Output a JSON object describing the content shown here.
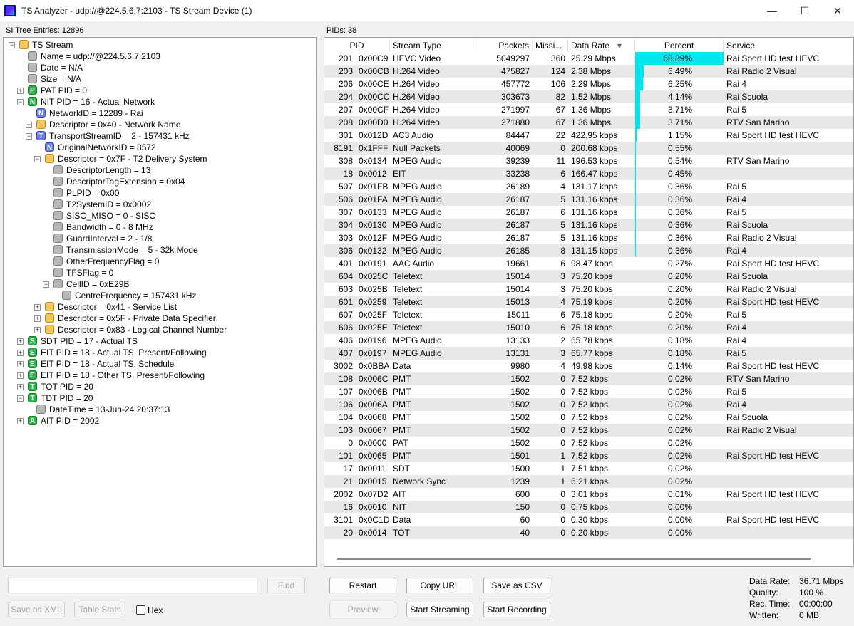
{
  "window": {
    "title": "TS Analyzer - udp://@224.5.6.7:2103 - TS Stream Device (1)",
    "minimize": "—",
    "maximize": "☐",
    "close": "✕"
  },
  "left": {
    "header": "SI Tree Entries: 12896",
    "tree": [
      {
        "depth": 0,
        "exp": "-",
        "icon": "folder",
        "letter": "",
        "text": "TS Stream"
      },
      {
        "depth": 1,
        "exp": "",
        "icon": "gray",
        "letter": "",
        "text": "Name = udp://@224.5.6.7:2103"
      },
      {
        "depth": 1,
        "exp": "",
        "icon": "gray",
        "letter": "",
        "text": "Date = N/A"
      },
      {
        "depth": 1,
        "exp": "",
        "icon": "gray",
        "letter": "",
        "text": "Size = N/A"
      },
      {
        "depth": 1,
        "exp": "+",
        "icon": "green",
        "letter": "P",
        "text": "PAT PID = 0"
      },
      {
        "depth": 1,
        "exp": "-",
        "icon": "green",
        "letter": "N",
        "text": "NIT PID = 16 - Actual Network"
      },
      {
        "depth": 2,
        "exp": "",
        "icon": "blue",
        "letter": "N",
        "text": "NetworkID = 12289 - Rai"
      },
      {
        "depth": 2,
        "exp": "+",
        "icon": "folder",
        "letter": "",
        "text": "Descriptor = 0x40 - Network Name"
      },
      {
        "depth": 2,
        "exp": "-",
        "icon": "blue",
        "letter": "T",
        "text": "TransportStreamID = 2 - 157431 kHz"
      },
      {
        "depth": 3,
        "exp": "",
        "icon": "blue",
        "letter": "N",
        "text": "OriginalNetworkID = 8572"
      },
      {
        "depth": 3,
        "exp": "-",
        "icon": "folder",
        "letter": "",
        "text": "Descriptor = 0x7F - T2 Delivery System"
      },
      {
        "depth": 4,
        "exp": "",
        "icon": "gray",
        "letter": "",
        "text": "DescriptorLength = 13"
      },
      {
        "depth": 4,
        "exp": "",
        "icon": "gray",
        "letter": "",
        "text": "DescriptorTagExtension = 0x04"
      },
      {
        "depth": 4,
        "exp": "",
        "icon": "gray",
        "letter": "",
        "text": "PLPID = 0x00"
      },
      {
        "depth": 4,
        "exp": "",
        "icon": "gray",
        "letter": "",
        "text": "T2SystemID = 0x0002"
      },
      {
        "depth": 4,
        "exp": "",
        "icon": "gray",
        "letter": "",
        "text": "SISO_MISO = 0 - SISO"
      },
      {
        "depth": 4,
        "exp": "",
        "icon": "gray",
        "letter": "",
        "text": "Bandwidth = 0 - 8 MHz"
      },
      {
        "depth": 4,
        "exp": "",
        "icon": "gray",
        "letter": "",
        "text": "GuardInterval = 2 - 1/8"
      },
      {
        "depth": 4,
        "exp": "",
        "icon": "gray",
        "letter": "",
        "text": "TransmissionMode = 5 - 32k Mode"
      },
      {
        "depth": 4,
        "exp": "",
        "icon": "gray",
        "letter": "",
        "text": "OtherFrequencyFlag = 0"
      },
      {
        "depth": 4,
        "exp": "",
        "icon": "gray",
        "letter": "",
        "text": "TFSFlag = 0"
      },
      {
        "depth": 4,
        "exp": "-",
        "icon": "gray",
        "letter": "",
        "text": "CellID = 0xE29B"
      },
      {
        "depth": 5,
        "exp": "",
        "icon": "gray",
        "letter": "",
        "text": "CentreFrequency = 157431 kHz"
      },
      {
        "depth": 3,
        "exp": "+",
        "icon": "folder",
        "letter": "",
        "text": "Descriptor = 0x41 - Service List"
      },
      {
        "depth": 3,
        "exp": "+",
        "icon": "folder",
        "letter": "",
        "text": "Descriptor = 0x5F - Private Data Specifier"
      },
      {
        "depth": 3,
        "exp": "+",
        "icon": "folder",
        "letter": "",
        "text": "Descriptor = 0x83 - Logical Channel Number"
      },
      {
        "depth": 1,
        "exp": "+",
        "icon": "green",
        "letter": "S",
        "text": "SDT PID = 17 - Actual TS"
      },
      {
        "depth": 1,
        "exp": "+",
        "icon": "green",
        "letter": "E",
        "text": "EIT PID = 18 - Actual TS, Present/Following"
      },
      {
        "depth": 1,
        "exp": "+",
        "icon": "green",
        "letter": "E",
        "text": "EIT PID = 18 - Actual TS, Schedule"
      },
      {
        "depth": 1,
        "exp": "+",
        "icon": "green",
        "letter": "E",
        "text": "EIT PID = 18 - Other TS, Present/Following"
      },
      {
        "depth": 1,
        "exp": "+",
        "icon": "green",
        "letter": "T",
        "text": "TOT PID = 20"
      },
      {
        "depth": 1,
        "exp": "-",
        "icon": "green",
        "letter": "T",
        "text": "TDT PID = 20"
      },
      {
        "depth": 2,
        "exp": "",
        "icon": "gray",
        "letter": "",
        "text": "DateTime = 13-Jun-24 20:37:13"
      },
      {
        "depth": 1,
        "exp": "+",
        "icon": "green",
        "letter": "A",
        "text": "AIT PID = 2002"
      }
    ],
    "find_button": "Find",
    "search_value": "",
    "save_xml_button": "Save as XML",
    "table_stats_button": "Table Stats",
    "hex_label": "Hex"
  },
  "right": {
    "header": "PIDs: 38",
    "columns": [
      "PID",
      "Stream Type",
      "Packets",
      "Missi...",
      "Data Rate",
      "Percent",
      "Service"
    ],
    "sort_arrow": "▾",
    "rows": [
      {
        "pid": "201",
        "hex": "0x00C9",
        "type": "HEVC Video",
        "packets": "5049297",
        "missing": "360",
        "rate": "25.29 Mbps",
        "percent": "68.89%",
        "pct": 68.89,
        "service": "Rai Sport HD test HEVC"
      },
      {
        "pid": "203",
        "hex": "0x00CB",
        "type": "H.264 Video",
        "packets": "475827",
        "missing": "124",
        "rate": "2.38 Mbps",
        "percent": "6.49%",
        "pct": 6.49,
        "service": "Rai Radio 2 Visual"
      },
      {
        "pid": "206",
        "hex": "0x00CE",
        "type": "H.264 Video",
        "packets": "457772",
        "missing": "106",
        "rate": "2.29 Mbps",
        "percent": "6.25%",
        "pct": 6.25,
        "service": "Rai 4"
      },
      {
        "pid": "204",
        "hex": "0x00CC",
        "type": "H.264 Video",
        "packets": "303673",
        "missing": "82",
        "rate": "1.52 Mbps",
        "percent": "4.14%",
        "pct": 4.14,
        "service": "Rai Scuola"
      },
      {
        "pid": "207",
        "hex": "0x00CF",
        "type": "H.264 Video",
        "packets": "271997",
        "missing": "67",
        "rate": "1.36 Mbps",
        "percent": "3.71%",
        "pct": 3.71,
        "service": "Rai 5"
      },
      {
        "pid": "208",
        "hex": "0x00D0",
        "type": "H.264 Video",
        "packets": "271880",
        "missing": "67",
        "rate": "1.36 Mbps",
        "percent": "3.71%",
        "pct": 3.71,
        "service": "RTV San Marino"
      },
      {
        "pid": "301",
        "hex": "0x012D",
        "type": "AC3 Audio",
        "packets": "84447",
        "missing": "22",
        "rate": "422.95 kbps",
        "percent": "1.15%",
        "pct": 1.15,
        "service": "Rai Sport HD test HEVC"
      },
      {
        "pid": "8191",
        "hex": "0x1FFF",
        "type": "Null Packets",
        "packets": "40069",
        "missing": "0",
        "rate": "200.68 kbps",
        "percent": "0.55%",
        "pct": 0.55,
        "service": ""
      },
      {
        "pid": "308",
        "hex": "0x0134",
        "type": "MPEG Audio",
        "packets": "39239",
        "missing": "11",
        "rate": "196.53 kbps",
        "percent": "0.54%",
        "pct": 0.54,
        "service": "RTV San Marino"
      },
      {
        "pid": "18",
        "hex": "0x0012",
        "type": "EIT",
        "packets": "33238",
        "missing": "6",
        "rate": "166.47 kbps",
        "percent": "0.45%",
        "pct": 0.45,
        "service": ""
      },
      {
        "pid": "507",
        "hex": "0x01FB",
        "type": "MPEG Audio",
        "packets": "26189",
        "missing": "4",
        "rate": "131.17 kbps",
        "percent": "0.36%",
        "pct": 0.36,
        "service": "Rai 5"
      },
      {
        "pid": "506",
        "hex": "0x01FA",
        "type": "MPEG Audio",
        "packets": "26187",
        "missing": "5",
        "rate": "131.16 kbps",
        "percent": "0.36%",
        "pct": 0.36,
        "service": "Rai 4"
      },
      {
        "pid": "307",
        "hex": "0x0133",
        "type": "MPEG Audio",
        "packets": "26187",
        "missing": "6",
        "rate": "131.16 kbps",
        "percent": "0.36%",
        "pct": 0.36,
        "service": "Rai 5"
      },
      {
        "pid": "304",
        "hex": "0x0130",
        "type": "MPEG Audio",
        "packets": "26187",
        "missing": "5",
        "rate": "131.16 kbps",
        "percent": "0.36%",
        "pct": 0.36,
        "service": "Rai Scuola"
      },
      {
        "pid": "303",
        "hex": "0x012F",
        "type": "MPEG Audio",
        "packets": "26187",
        "missing": "5",
        "rate": "131.16 kbps",
        "percent": "0.36%",
        "pct": 0.36,
        "service": "Rai Radio 2 Visual"
      },
      {
        "pid": "306",
        "hex": "0x0132",
        "type": "MPEG Audio",
        "packets": "26185",
        "missing": "8",
        "rate": "131.15 kbps",
        "percent": "0.36%",
        "pct": 0.36,
        "service": "Rai 4"
      },
      {
        "pid": "401",
        "hex": "0x0191",
        "type": "AAC Audio",
        "packets": "19661",
        "missing": "6",
        "rate": "98.47 kbps",
        "percent": "0.27%",
        "pct": 0.27,
        "service": "Rai Sport HD test HEVC"
      },
      {
        "pid": "604",
        "hex": "0x025C",
        "type": "Teletext",
        "packets": "15014",
        "missing": "3",
        "rate": "75.20 kbps",
        "percent": "0.20%",
        "pct": 0.2,
        "service": "Rai Scuola"
      },
      {
        "pid": "603",
        "hex": "0x025B",
        "type": "Teletext",
        "packets": "15014",
        "missing": "3",
        "rate": "75.20 kbps",
        "percent": "0.20%",
        "pct": 0.2,
        "service": "Rai Radio 2 Visual"
      },
      {
        "pid": "601",
        "hex": "0x0259",
        "type": "Teletext",
        "packets": "15013",
        "missing": "4",
        "rate": "75.19 kbps",
        "percent": "0.20%",
        "pct": 0.2,
        "service": "Rai Sport HD test HEVC"
      },
      {
        "pid": "607",
        "hex": "0x025F",
        "type": "Teletext",
        "packets": "15011",
        "missing": "6",
        "rate": "75.18 kbps",
        "percent": "0.20%",
        "pct": 0.2,
        "service": "Rai 5"
      },
      {
        "pid": "606",
        "hex": "0x025E",
        "type": "Teletext",
        "packets": "15010",
        "missing": "6",
        "rate": "75.18 kbps",
        "percent": "0.20%",
        "pct": 0.2,
        "service": "Rai 4"
      },
      {
        "pid": "406",
        "hex": "0x0196",
        "type": "MPEG Audio",
        "packets": "13133",
        "missing": "2",
        "rate": "65.78 kbps",
        "percent": "0.18%",
        "pct": 0.18,
        "service": "Rai 4"
      },
      {
        "pid": "407",
        "hex": "0x0197",
        "type": "MPEG Audio",
        "packets": "13131",
        "missing": "3",
        "rate": "65.77 kbps",
        "percent": "0.18%",
        "pct": 0.18,
        "service": "Rai 5"
      },
      {
        "pid": "3002",
        "hex": "0x0BBA",
        "type": "Data",
        "packets": "9980",
        "missing": "4",
        "rate": "49.98 kbps",
        "percent": "0.14%",
        "pct": 0.14,
        "service": "Rai Sport HD test HEVC"
      },
      {
        "pid": "108",
        "hex": "0x006C",
        "type": "PMT",
        "packets": "1502",
        "missing": "0",
        "rate": "7.52 kbps",
        "percent": "0.02%",
        "pct": 0.02,
        "service": "RTV San Marino"
      },
      {
        "pid": "107",
        "hex": "0x006B",
        "type": "PMT",
        "packets": "1502",
        "missing": "0",
        "rate": "7.52 kbps",
        "percent": "0.02%",
        "pct": 0.02,
        "service": "Rai 5"
      },
      {
        "pid": "106",
        "hex": "0x006A",
        "type": "PMT",
        "packets": "1502",
        "missing": "0",
        "rate": "7.52 kbps",
        "percent": "0.02%",
        "pct": 0.02,
        "service": "Rai 4"
      },
      {
        "pid": "104",
        "hex": "0x0068",
        "type": "PMT",
        "packets": "1502",
        "missing": "0",
        "rate": "7.52 kbps",
        "percent": "0.02%",
        "pct": 0.02,
        "service": "Rai Scuola"
      },
      {
        "pid": "103",
        "hex": "0x0067",
        "type": "PMT",
        "packets": "1502",
        "missing": "0",
        "rate": "7.52 kbps",
        "percent": "0.02%",
        "pct": 0.02,
        "service": "Rai Radio 2 Visual"
      },
      {
        "pid": "0",
        "hex": "0x0000",
        "type": "PAT",
        "packets": "1502",
        "missing": "0",
        "rate": "7.52 kbps",
        "percent": "0.02%",
        "pct": 0.02,
        "service": ""
      },
      {
        "pid": "101",
        "hex": "0x0065",
        "type": "PMT",
        "packets": "1501",
        "missing": "1",
        "rate": "7.52 kbps",
        "percent": "0.02%",
        "pct": 0.02,
        "service": "Rai Sport HD test HEVC"
      },
      {
        "pid": "17",
        "hex": "0x0011",
        "type": "SDT",
        "packets": "1500",
        "missing": "1",
        "rate": "7.51 kbps",
        "percent": "0.02%",
        "pct": 0.02,
        "service": ""
      },
      {
        "pid": "21",
        "hex": "0x0015",
        "type": "Network Sync",
        "packets": "1239",
        "missing": "1",
        "rate": "6.21 kbps",
        "percent": "0.02%",
        "pct": 0.02,
        "service": ""
      },
      {
        "pid": "2002",
        "hex": "0x07D2",
        "type": "AIT",
        "packets": "600",
        "missing": "0",
        "rate": "3.01 kbps",
        "percent": "0.01%",
        "pct": 0.01,
        "service": "Rai Sport HD test HEVC"
      },
      {
        "pid": "16",
        "hex": "0x0010",
        "type": "NIT",
        "packets": "150",
        "missing": "0",
        "rate": "0.75 kbps",
        "percent": "0.00%",
        "pct": 0.0,
        "service": ""
      },
      {
        "pid": "3101",
        "hex": "0x0C1D",
        "type": "Data",
        "packets": "60",
        "missing": "0",
        "rate": "0.30 kbps",
        "percent": "0.00%",
        "pct": 0.0,
        "service": "Rai Sport HD test HEVC"
      },
      {
        "pid": "20",
        "hex": "0x0014",
        "type": "TOT",
        "packets": "40",
        "missing": "0",
        "rate": "0.20 kbps",
        "percent": "0.00%",
        "pct": 0.0,
        "service": ""
      }
    ],
    "buttons": {
      "restart": "Restart",
      "copy_url": "Copy URL",
      "save_csv": "Save as CSV",
      "preview": "Preview",
      "start_streaming": "Start Streaming",
      "start_recording": "Start Recording"
    },
    "stats": {
      "data_rate_label": "Data Rate:",
      "data_rate_value": "36.71 Mbps",
      "quality_label": "Quality:",
      "quality_value": "100 %",
      "rec_time_label": "Rec. Time:",
      "rec_time_value": "00:00:00",
      "written_label": "Written:",
      "written_value": "0 MB"
    }
  },
  "colors": {
    "percent_bar": "#00e5ee",
    "row_alt": "#e8e8e8"
  }
}
